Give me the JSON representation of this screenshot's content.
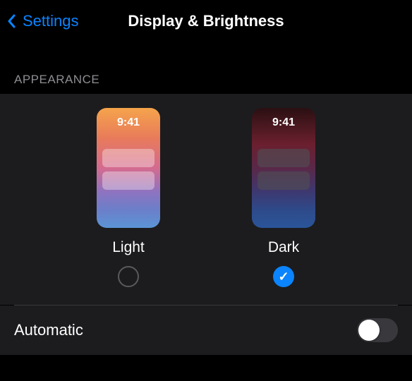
{
  "nav": {
    "back_label": "Settings",
    "title": "Display & Brightness"
  },
  "section": {
    "header": "APPEARANCE"
  },
  "appearance": {
    "light": {
      "label": "Light",
      "time": "9:41",
      "selected": false
    },
    "dark": {
      "label": "Dark",
      "time": "9:41",
      "selected": true
    }
  },
  "automatic": {
    "label": "Automatic",
    "enabled": false
  },
  "colors": {
    "accent": "#0a84ff"
  }
}
